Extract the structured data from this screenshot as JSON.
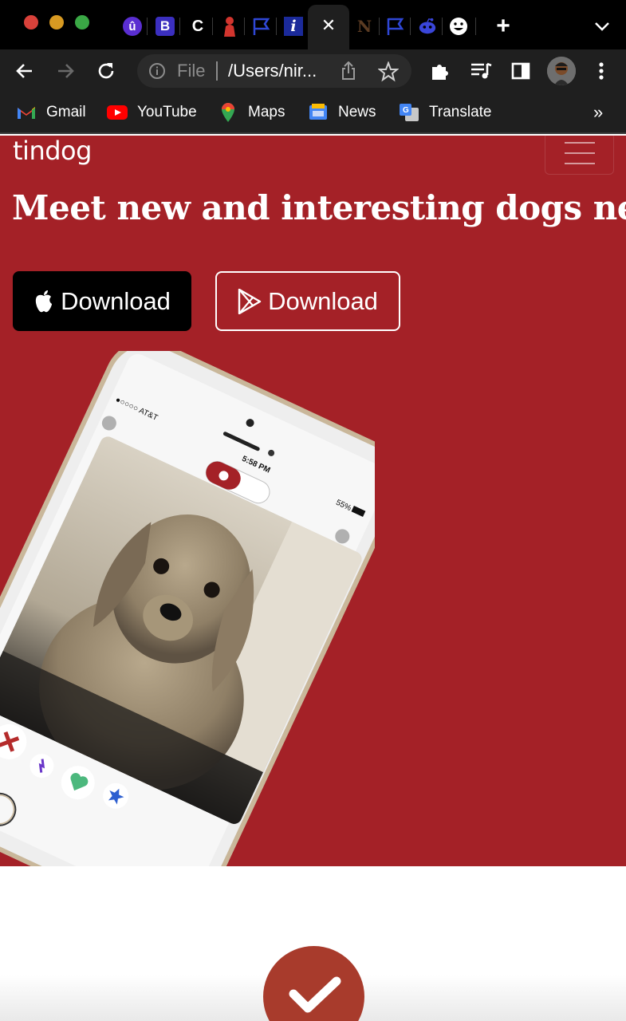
{
  "browser": {
    "tabs": [
      {
        "icon": "shield-u-icon",
        "glyph": "û"
      },
      {
        "icon": "bootstrap-icon",
        "glyph": "B"
      },
      {
        "icon": "c-icon",
        "glyph": "C"
      },
      {
        "icon": "red-figure-icon",
        "glyph": ""
      },
      {
        "icon": "flag-icon",
        "glyph": ""
      },
      {
        "icon": "info-i-icon",
        "glyph": "i"
      },
      {
        "icon": "close-icon",
        "glyph": "✕"
      },
      {
        "icon": "notion-icon",
        "glyph": "N"
      },
      {
        "icon": "flag-icon",
        "glyph": ""
      },
      {
        "icon": "reddit-icon",
        "glyph": ""
      },
      {
        "icon": "smiley-icon",
        "glyph": ""
      }
    ],
    "new_tab_glyph": "+",
    "omnibox": {
      "scheme": "File",
      "url": "/Users/nir..."
    },
    "bookmarks": [
      {
        "label": "Gmail",
        "icon": "gmail-icon"
      },
      {
        "label": "YouTube",
        "icon": "youtube-icon"
      },
      {
        "label": "Maps",
        "icon": "maps-icon"
      },
      {
        "label": "News",
        "icon": "news-icon"
      },
      {
        "label": "Translate",
        "icon": "translate-icon"
      }
    ],
    "bookmarks_more": "»",
    "colors": {
      "tabbar": "#000000",
      "toolbar": "#1f1f1f"
    }
  },
  "page": {
    "brand": "tindog",
    "headline": "Meet new and interesting dogs nearby.",
    "buttons": {
      "apple_download": "Download",
      "play_download": "Download"
    },
    "phone": {
      "carrier": "●○○○○ AT&T",
      "time": "5:58 PM",
      "battery": "55%"
    },
    "colors": {
      "hero_bg": "#a42127",
      "check_circle": "#a83b2c"
    }
  }
}
